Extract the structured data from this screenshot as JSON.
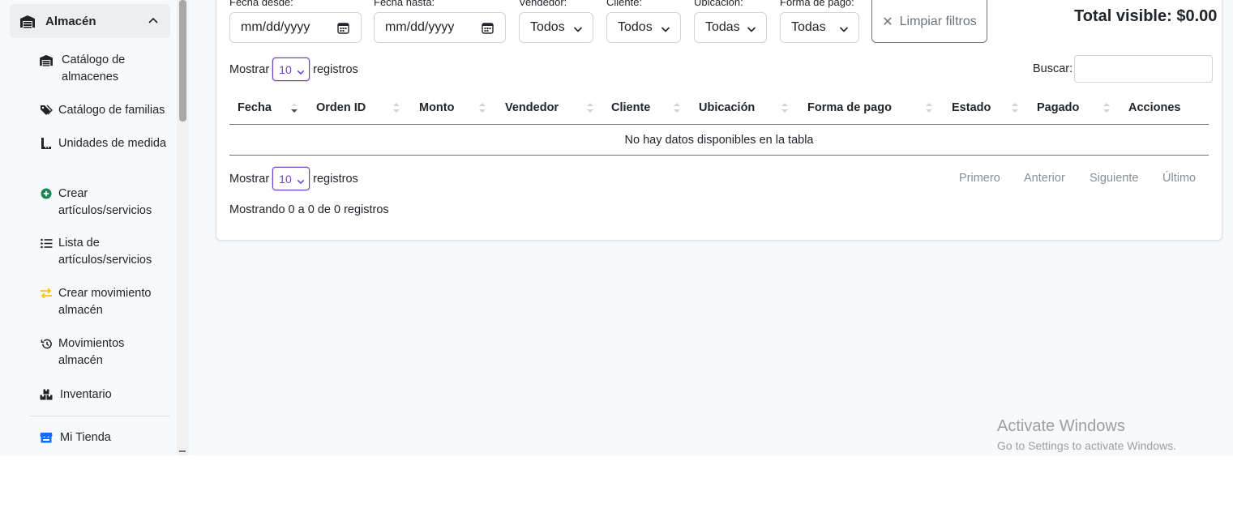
{
  "sidebar": {
    "group": {
      "label": "Almacén",
      "icon": "warehouse-icon",
      "expanded": true
    },
    "items": [
      {
        "label": "Catálogo de almacenes",
        "icon": "warehouse-icon"
      },
      {
        "label": "Catálogo de familias",
        "icon": "tags-icon"
      },
      {
        "label": "Unidades de medida",
        "icon": "ruler-icon"
      },
      {
        "label": "Crear artículos/servicios",
        "icon": "plus-circle-icon",
        "color": "#198754"
      },
      {
        "label": "Lista de artículos/servicios",
        "icon": "list-icon"
      },
      {
        "label": "Crear movimiento almacén",
        "icon": "arrows-exchange-icon",
        "color": "#ffc107"
      },
      {
        "label": "Movimientos almacén",
        "icon": "history-icon"
      },
      {
        "label": "Inventario",
        "icon": "boxes-icon"
      }
    ],
    "store": {
      "label": "Mi Tienda",
      "icon": "store-icon",
      "color": "#0d6efd"
    }
  },
  "filters": {
    "date_from_label": "Fecha desde:",
    "date_to_label": "Fecha hasta:",
    "date_placeholder": "mm/dd/yyyy",
    "seller_label": "Vendedor:",
    "seller_value": "Todos",
    "client_label": "Cliente:",
    "client_value": "Todos",
    "location_label": "Ubicación:",
    "location_value": "Todas",
    "payment_label": "Forma de pago:",
    "payment_value": "Todas",
    "clear_label": "Limpiar filtros"
  },
  "total_visible": "Total visible: $0.00",
  "table": {
    "show_label": "Mostrar",
    "records_label": "registros",
    "page_length": "10",
    "search_label": "Buscar:",
    "columns": [
      "Fecha",
      "Orden ID",
      "Monto",
      "Vendedor",
      "Cliente",
      "Ubicación",
      "Forma de pago",
      "Estado",
      "Pagado",
      "Acciones"
    ],
    "empty_message": "No hay datos disponibles en la tabla",
    "info": "Mostrando 0 a 0 de 0 registros",
    "pagination": {
      "first": "Primero",
      "previous": "Anterior",
      "next": "Siguiente",
      "last": "Último"
    }
  },
  "watermark": {
    "title": "Activate Windows",
    "subtitle": "Go to Settings to activate Windows."
  },
  "colors": {
    "accent": "#6f42c1",
    "muted": "#6c757d"
  }
}
